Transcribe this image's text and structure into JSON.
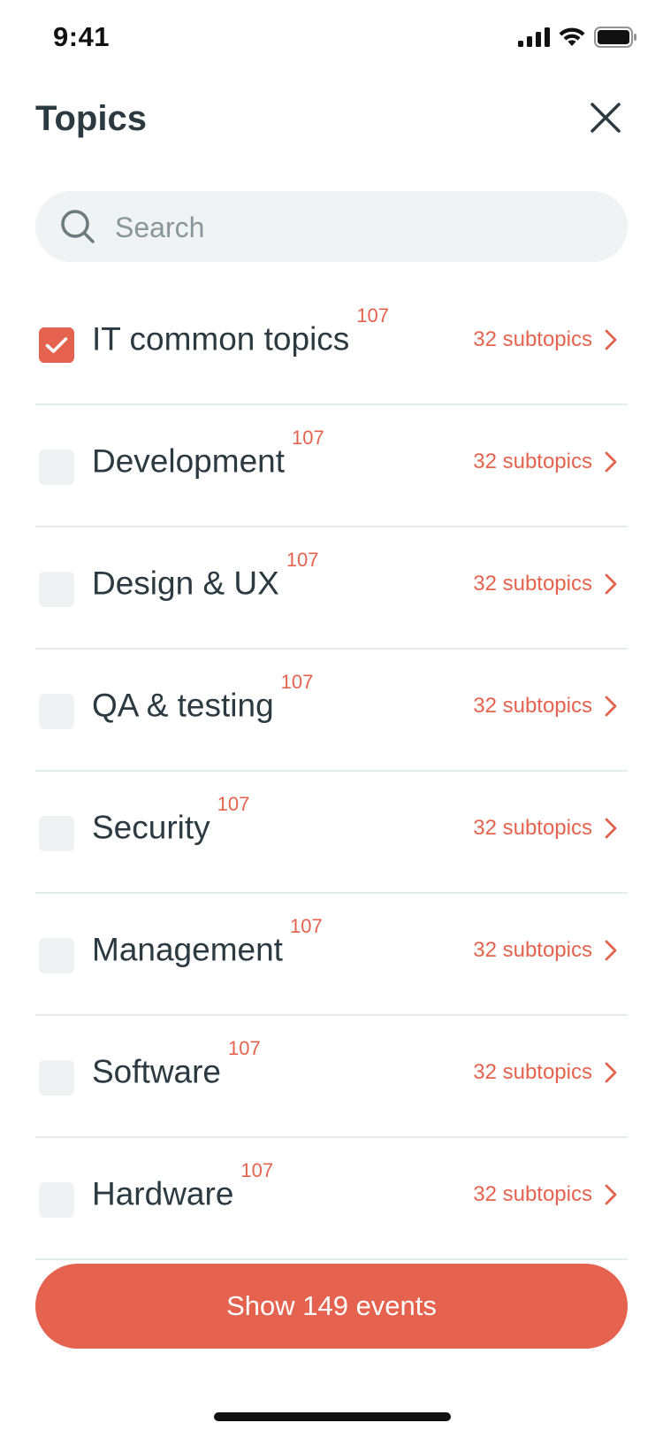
{
  "status_bar": {
    "time": "9:41"
  },
  "header": {
    "title": "Topics"
  },
  "search": {
    "placeholder": "Search",
    "value": ""
  },
  "topics": [
    {
      "label": "IT common topics",
      "count": "107",
      "subtopics": "32 subtopics",
      "checked": true
    },
    {
      "label": "Development",
      "count": "107",
      "subtopics": "32 subtopics",
      "checked": false
    },
    {
      "label": "Design & UX",
      "count": "107",
      "subtopics": "32 subtopics",
      "checked": false
    },
    {
      "label": "QA & testing",
      "count": "107",
      "subtopics": "32 subtopics",
      "checked": false
    },
    {
      "label": "Security",
      "count": "107",
      "subtopics": "32 subtopics",
      "checked": false
    },
    {
      "label": "Management",
      "count": "107",
      "subtopics": "32 subtopics",
      "checked": false
    },
    {
      "label": "Software",
      "count": "107",
      "subtopics": "32 subtopics",
      "checked": false
    },
    {
      "label": "Hardware",
      "count": "107",
      "subtopics": "32 subtopics",
      "checked": false
    }
  ],
  "cta": {
    "label": "Show 149 events"
  },
  "colors": {
    "accent": "#e5634e",
    "text": "#2b3a40",
    "checkbox_bg": "#eef2f2",
    "search_bg": "#f0f3f3"
  },
  "icons": {
    "close": "close-icon",
    "search": "search-icon",
    "check": "check-icon",
    "chevron": "chevron-right-icon",
    "signal": "cellular-signal-icon",
    "wifi": "wifi-icon",
    "battery": "battery-icon"
  }
}
